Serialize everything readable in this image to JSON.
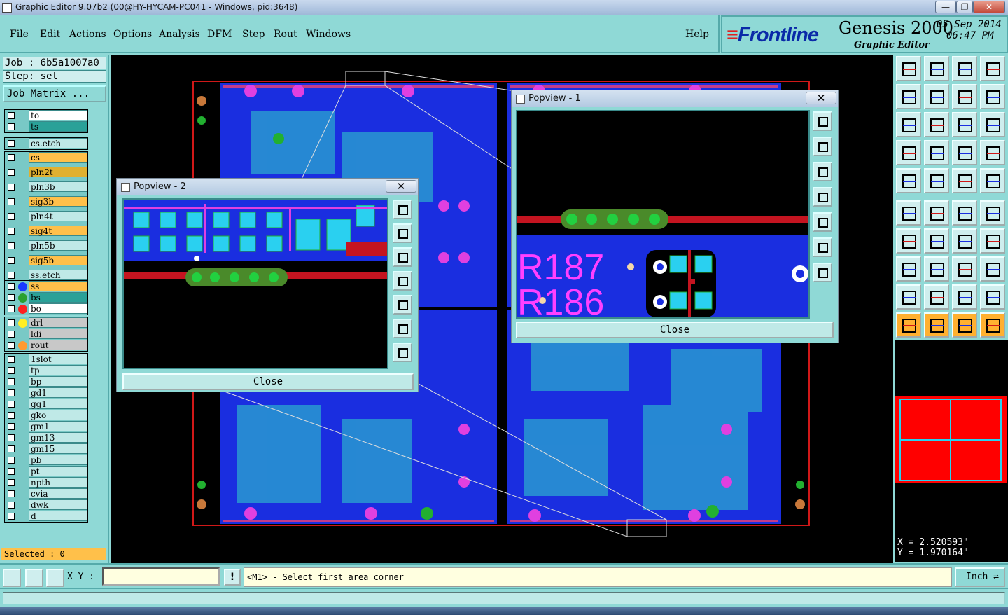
{
  "window": {
    "title": "Graphic Editor 9.07b2 (00@HY-HYCAM-PC041 - Windows, pid:3648)",
    "min": "—",
    "max": "❐",
    "close": "✕"
  },
  "menu": [
    "File",
    "Edit",
    "Actions",
    "Options",
    "Analysis",
    "DFM",
    "Step",
    "Rout",
    "Windows"
  ],
  "help": "Help",
  "brand": {
    "logo": "Frontline",
    "product": "Genesis 2000",
    "subtitle": "Graphic Editor",
    "date": "05 Sep 2014",
    "time": "06:47 PM"
  },
  "job": {
    "job_label": "Job : 6b5a1007a0",
    "step_label": "Step: set",
    "matrix_button": "Job Matrix ..."
  },
  "layers": [
    {
      "name": "to",
      "bg": "#ffffff"
    },
    {
      "name": "ts",
      "bg": "#2aa198"
    },
    {
      "name": "cs.etch",
      "bg": "#bfe9e7"
    },
    {
      "name": "cs",
      "bg": "#ffc04a"
    },
    {
      "name": "pln2t",
      "bg": "#e0b030"
    },
    {
      "name": "pln3b",
      "bg": "#bfe9e7"
    },
    {
      "name": "sig3b",
      "bg": "#ffc04a"
    },
    {
      "name": "pln4t",
      "bg": "#bfe9e7"
    },
    {
      "name": "sig4t",
      "bg": "#ffc04a"
    },
    {
      "name": "pln5b",
      "bg": "#bfe9e7"
    },
    {
      "name": "sig5b",
      "bg": "#ffc04a"
    },
    {
      "name": "ss.etch",
      "bg": "#bfe9e7"
    },
    {
      "name": "ss",
      "bg": "#ffc04a",
      "dot": "#1a3aff"
    },
    {
      "name": "bs",
      "bg": "#2aa198",
      "dot": "#2aa030"
    },
    {
      "name": "bo",
      "bg": "#ffffff",
      "dot": "#ff2020"
    },
    {
      "name": "drl",
      "bg": "#c8c8c8",
      "dot": "#ffee22"
    },
    {
      "name": "ldi",
      "bg": "#c8c8c8"
    },
    {
      "name": "rout",
      "bg": "#c8c8c8",
      "dot": "#ff9a30"
    },
    {
      "name": "1slot",
      "bg": "#bfe9e7"
    },
    {
      "name": "tp",
      "bg": "#bfe9e7"
    },
    {
      "name": "bp",
      "bg": "#bfe9e7"
    },
    {
      "name": "gd1",
      "bg": "#bfe9e7"
    },
    {
      "name": "gg1",
      "bg": "#bfe9e7"
    },
    {
      "name": "gko",
      "bg": "#bfe9e7"
    },
    {
      "name": "gm1",
      "bg": "#bfe9e7"
    },
    {
      "name": "gm13",
      "bg": "#bfe9e7"
    },
    {
      "name": "gm15",
      "bg": "#bfe9e7"
    },
    {
      "name": "pb",
      "bg": "#bfe9e7"
    },
    {
      "name": "pt",
      "bg": "#bfe9e7"
    },
    {
      "name": "npth",
      "bg": "#bfe9e7"
    },
    {
      "name": "cvia",
      "bg": "#bfe9e7"
    },
    {
      "name": "dwk",
      "bg": "#bfe9e7"
    },
    {
      "name": "d",
      "bg": "#bfe9e7"
    }
  ],
  "selected": "Selected : 0",
  "popview1": {
    "title": "Popview - 1",
    "close": "Close",
    "x": "✕",
    "text": "R187 R186"
  },
  "popview2": {
    "title": "Popview - 2",
    "close": "Close",
    "x": "✕"
  },
  "coords": {
    "x": "X = 2.520593\"",
    "y": "Y = 1.970164\""
  },
  "bottom": {
    "xy_label": "X Y :",
    "xy_value": "",
    "bang": "!",
    "message": "<M1> - Select first area corner",
    "unit": "Inch"
  }
}
